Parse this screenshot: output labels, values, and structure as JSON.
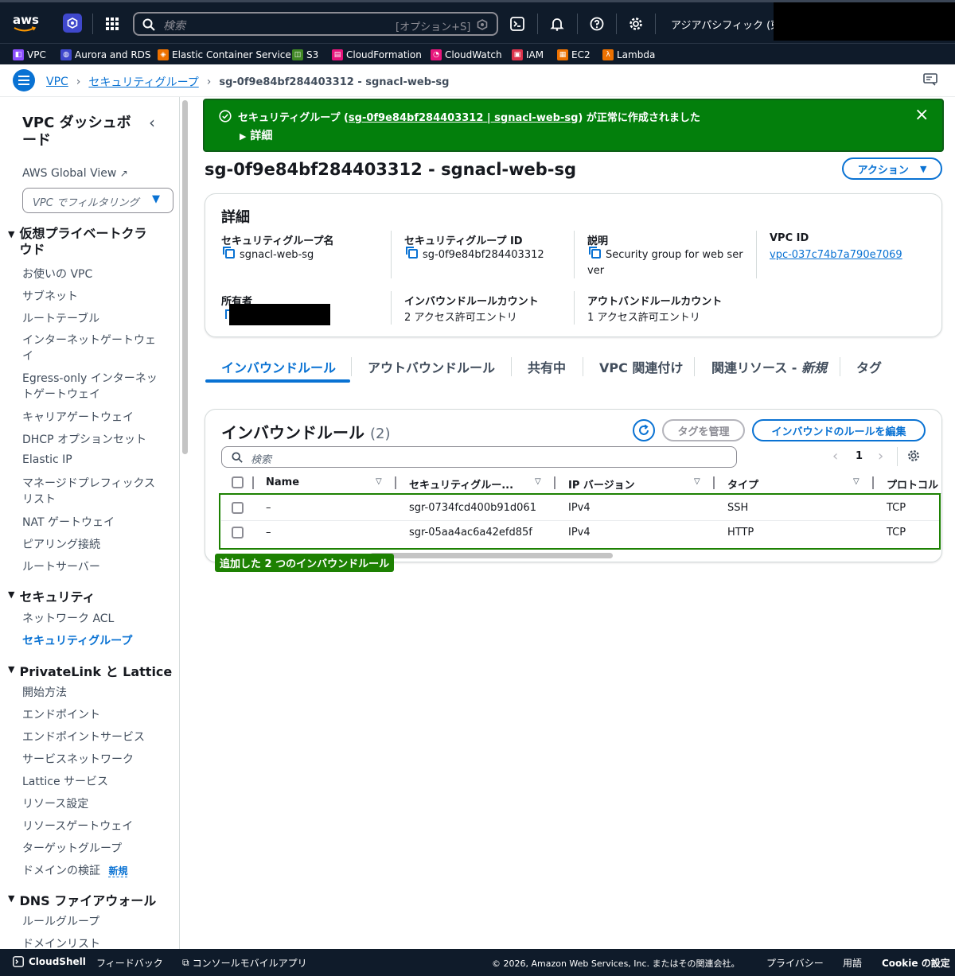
{
  "topnav": {
    "logo": "aws",
    "search_placeholder": "検索",
    "search_shortcut": "[オプション+S]",
    "region": "アジアパシフィック (東京)"
  },
  "favorites": [
    {
      "label": "VPC",
      "color": "#8c4fff"
    },
    {
      "label": "Aurora and RDS",
      "color": "#3f48cc"
    },
    {
      "label": "Elastic Container Service",
      "color": "#ed7100"
    },
    {
      "label": "S3",
      "color": "#3f8624"
    },
    {
      "label": "CloudFormation",
      "color": "#e7157b"
    },
    {
      "label": "CloudWatch",
      "color": "#e7157b"
    },
    {
      "label": "IAM",
      "color": "#dd344c"
    },
    {
      "label": "EC2",
      "color": "#ed7100"
    },
    {
      "label": "Lambda",
      "color": "#ed7100"
    }
  ],
  "breadcrumb": {
    "items": [
      "VPC",
      "セキュリティグループ"
    ],
    "current": "sg-0f9e84bf284403312 - sgnacl-web-sg"
  },
  "sidebar": {
    "title": "VPC ダッシュボード",
    "global_view": "AWS Global View",
    "filter_placeholder": "VPC でフィルタリング",
    "sections": [
      {
        "title": "仮想プライベートクラウド",
        "items": [
          "お使いの VPC",
          "サブネット",
          "ルートテーブル",
          "インターネットゲートウェイ",
          "Egress-only インターネットゲートウェイ",
          "キャリアゲートウェイ",
          "DHCP オプションセット",
          "Elastic IP",
          "マネージドプレフィックスリスト",
          "NAT ゲートウェイ",
          "ピアリング接続",
          "ルートサーバー"
        ]
      },
      {
        "title": "セキュリティ",
        "items": [
          "ネットワーク ACL",
          "セキュリティグループ"
        ]
      },
      {
        "title": "PrivateLink と Lattice",
        "items": [
          "開始方法",
          "エンドポイント",
          "エンドポイントサービス",
          "サービスネットワーク",
          "Lattice サービス",
          "リソース設定",
          "リソースゲートウェイ",
          "ターゲットグループ",
          "ドメインの検証"
        ]
      },
      {
        "title": "DNS ファイアウォール",
        "items": [
          "ルールグループ",
          "ドメインリスト"
        ]
      }
    ],
    "new_badge": "新規"
  },
  "flash": {
    "prefix": "セキュリティグループ (",
    "link": "sg-0f9e84bf284403312 | sgnacl-web-sg",
    "suffix": ") が正常に作成されました",
    "details": "詳細",
    "color": "#037f0c"
  },
  "page": {
    "title": "sg-0f9e84bf284403312 - sgnacl-web-sg",
    "actions_button": "アクション"
  },
  "details": {
    "heading": "詳細",
    "fields": [
      {
        "label": "セキュリティグループ名",
        "value": "sgnacl-web-sg"
      },
      {
        "label": "セキュリティグループ ID",
        "value": "sg-0f9e84bf284403312"
      },
      {
        "label": "説明",
        "value": "Security group for web ser",
        "value2": "ver"
      },
      {
        "label": "VPC ID",
        "value": "vpc-037c74b7a790e7069"
      },
      {
        "label": "所有者",
        "value": ""
      },
      {
        "label": "インバウンドルールカウント",
        "value": "2 アクセス許可エントリ"
      },
      {
        "label": "アウトバンドルールカウント",
        "value": "1 アクセス許可エントリ"
      }
    ]
  },
  "tabs": [
    "インバウンドルール",
    "アウトバウンドルール",
    "共有中",
    "VPC 関連付け",
    "関連リソース - ",
    "新規",
    "タグ"
  ],
  "rules": {
    "title": "インバウンドルール",
    "count": "(2)",
    "manage_tags": "タグを管理",
    "edit_button": "インバウンドのルールを編集",
    "search_placeholder": "検索",
    "page": "1",
    "columns": [
      "Name",
      "セキュリティグルー...",
      "IP バージョン",
      "タイプ",
      "プロトコル"
    ],
    "rows": [
      {
        "name": "–",
        "id": "sgr-0734fcd400b91d061",
        "ip": "IPv4",
        "type": "SSH",
        "proto": "TCP"
      },
      {
        "name": "–",
        "id": "sgr-05aa4ac6a42efd85f",
        "ip": "IPv4",
        "type": "HTTP",
        "proto": "TCP"
      }
    ],
    "annotation": "追加した 2 つのインバウンドルール"
  },
  "footer": {
    "cloudshell": "CloudShell",
    "feedback": "フィードバック",
    "mobile": "コンソールモバイルアプリ",
    "copyright": "© 2026, Amazon Web Services, Inc. またはその関連会社。",
    "privacy": "プライバシー",
    "terms": "用語",
    "cookie": "Cookie の設定"
  }
}
